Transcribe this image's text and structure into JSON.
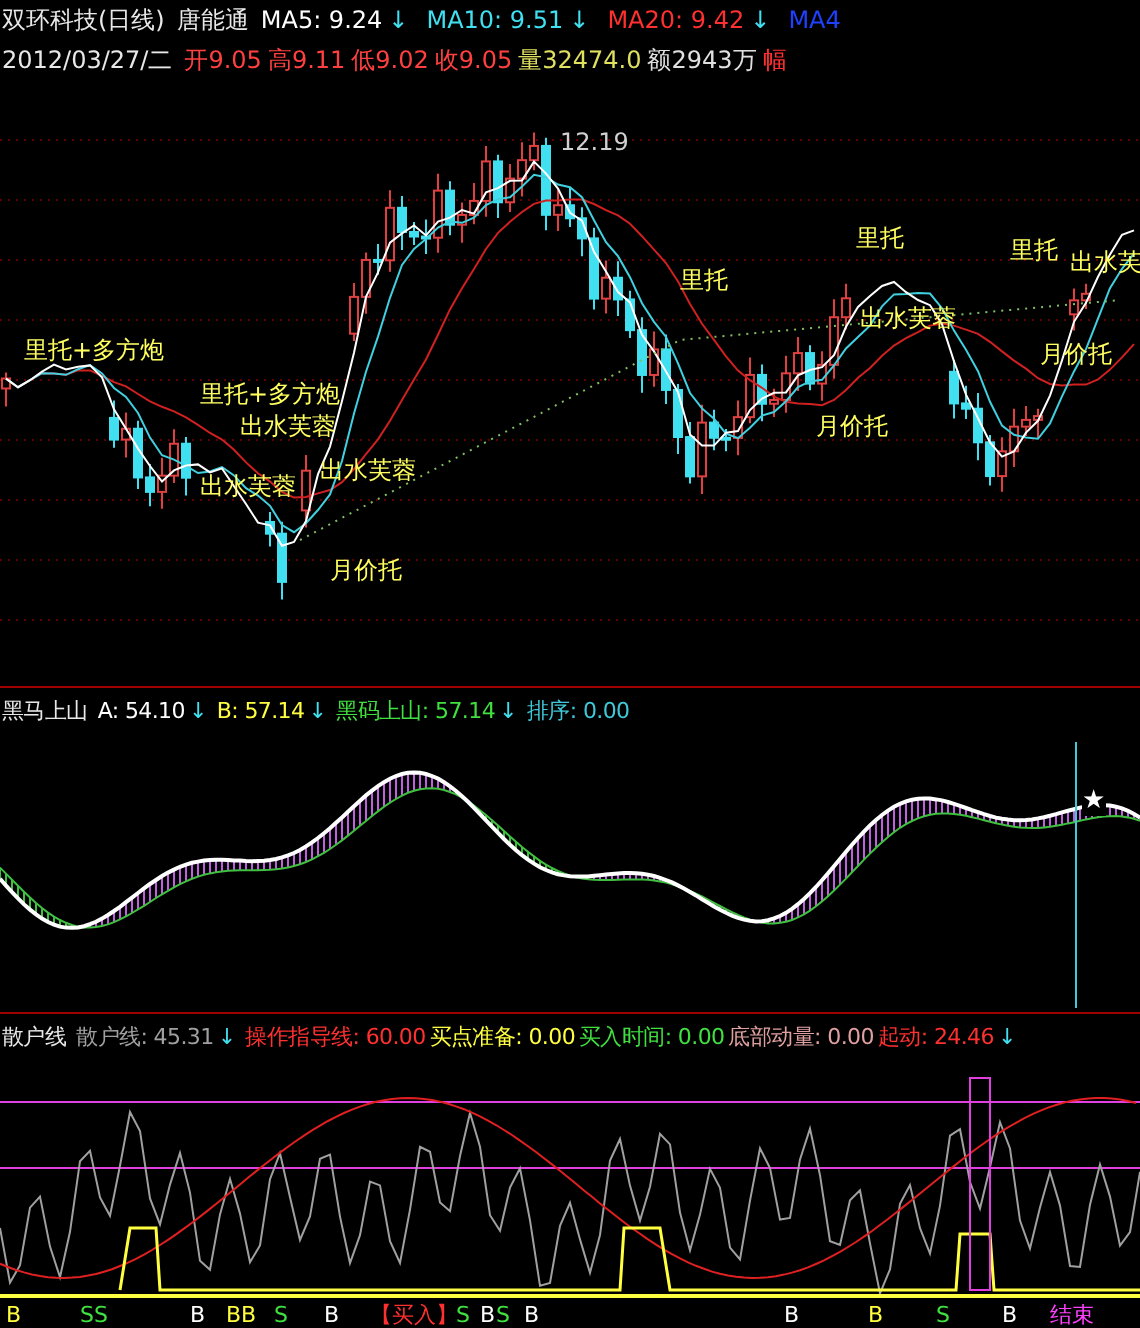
{
  "header": {
    "stock": "双环科技(日线)",
    "author": "唐能通",
    "indicators": [
      {
        "label": "MA5: 9.24",
        "arrow": "↓",
        "color": "#ffffff"
      },
      {
        "label": "MA10: 9.51",
        "arrow": "↓",
        "color": "#40e0f0"
      },
      {
        "label": "MA20: 9.42",
        "arrow": "↓",
        "color": "#ff3030"
      },
      {
        "label": "MA4",
        "color": "#2040ff"
      }
    ],
    "date": "2012/03/27/二",
    "quotes": [
      {
        "text": "开9.05",
        "color": "#ff4040"
      },
      {
        "text": "高9.11",
        "color": "#ff4040"
      },
      {
        "text": "低9.02",
        "color": "#ff4040"
      },
      {
        "text": "收9.05",
        "color": "#ff4040"
      },
      {
        "text": "量32474.0",
        "color": "#e0e060"
      },
      {
        "text": "额2943万",
        "color": "#e0e0e0"
      },
      {
        "text": "幅",
        "color": "#ff3030"
      }
    ]
  },
  "main_chart": {
    "peak_label": "12.19",
    "annotations": [
      "里托+多方炮",
      "里托+多方炮",
      "出水芙蓉",
      "出水芙蓉",
      "出水芙蓉",
      "月价托",
      "里托",
      "月价托",
      "里托",
      "出水芙蓉",
      "里托",
      "月价托",
      "出水芙"
    ]
  },
  "panel_2": {
    "name": "黑马上山",
    "values": [
      {
        "label": "A: 54.10",
        "arrow": "↓",
        "color": "#ffffff"
      },
      {
        "label": "B: 57.14",
        "arrow": "↓",
        "color": "#ffff40"
      },
      {
        "label": "黑码上山: 57.14",
        "arrow": "↓",
        "color": "#40e040"
      },
      {
        "label": "排序: 0.00",
        "color": "#40c8d8"
      }
    ],
    "signal": "★"
  },
  "panel_3": {
    "name": "散户线",
    "values": [
      {
        "label": "散户线: 45.31",
        "arrow": "↓",
        "color": "#a0a0a0"
      },
      {
        "label": "操作指导线: 60.00",
        "color": "#ff3030"
      },
      {
        "label": "买点准备: 0.00",
        "color": "#ffff40"
      },
      {
        "label": "买入时间: 0.00",
        "color": "#40e040"
      },
      {
        "label": "底部动量: 0.00",
        "color": "#e0a0a0"
      },
      {
        "label": "起动: 24.46",
        "arrow": "↓",
        "color": "#ff3030"
      }
    ],
    "markers": [
      {
        "text": "B",
        "color": "#ffff40"
      },
      {
        "text": "SS",
        "color": "#40e040"
      },
      {
        "text": "B",
        "color": "#ffffff"
      },
      {
        "text": "BB",
        "color": "#ffff40"
      },
      {
        "text": "S",
        "color": "#40e040"
      },
      {
        "text": "B",
        "color": "#ffffff"
      },
      {
        "text": "【买入】",
        "color": "#ff3030"
      },
      {
        "text": "S",
        "color": "#40e040"
      },
      {
        "text": "B",
        "color": "#ffffff"
      },
      {
        "text": "S",
        "color": "#40e040"
      },
      {
        "text": "B",
        "color": "#ffffff"
      },
      {
        "text": "B",
        "color": "#ffffff"
      },
      {
        "text": "B",
        "color": "#ffff40"
      },
      {
        "text": "S",
        "color": "#40e040"
      },
      {
        "text": "B",
        "color": "#ffffff"
      },
      {
        "text": "结束",
        "color": "#ff40ff"
      }
    ]
  }
}
